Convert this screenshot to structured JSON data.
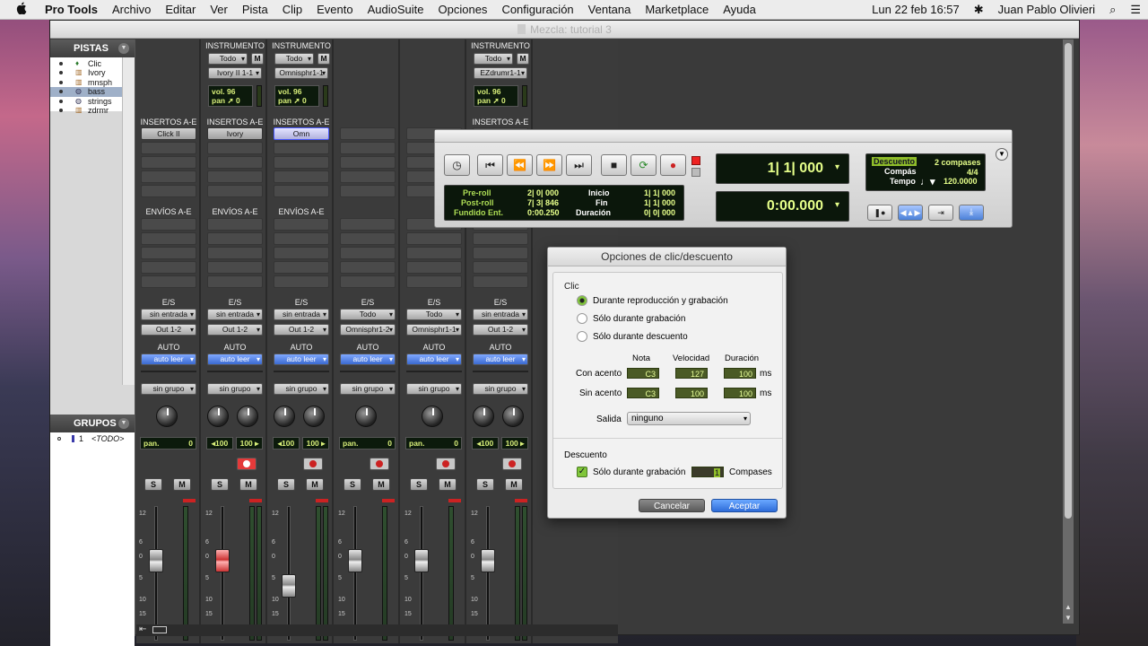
{
  "menubar": {
    "apple": "",
    "app": "Pro Tools",
    "items": [
      "Archivo",
      "Editar",
      "Ver",
      "Pista",
      "Clip",
      "Evento",
      "AudioSuite",
      "Opciones",
      "Configuración",
      "Ventana",
      "Marketplace",
      "Ayuda"
    ],
    "clock": "Lun 22 feb  16:57",
    "user": "Juan Pablo Olivieri",
    "search_icon": "⌕",
    "list_icon": "☰"
  },
  "window": {
    "title": "Mezcla: tutorial 3"
  },
  "tracks_panel": {
    "title": "PISTAS",
    "tracks": [
      {
        "name": "Clic",
        "icon": "metronome-icon"
      },
      {
        "name": "Ivory",
        "icon": "instrument-icon"
      },
      {
        "name": "mnsph",
        "icon": "instrument-icon"
      },
      {
        "name": "bass",
        "icon": "audio-icon"
      },
      {
        "name": "strings",
        "icon": "audio-icon"
      },
      {
        "name": "zdrmr",
        "icon": "instrument-icon"
      }
    ],
    "groups_title": "GRUPOS",
    "group_num": "1",
    "group_name": "<TODO>"
  },
  "mixer": {
    "strips": [
      {
        "header": "",
        "todo": "",
        "m": "",
        "inst": "",
        "vol": "",
        "pan": "",
        "insert_label": "INSERTOS A-E",
        "insert1": "Click II",
        "sends_label": "ENVÍOS A-E",
        "io_label": "E/S",
        "in": "sin entrada",
        "out": "Out 1-2",
        "auto_label": "AUTO",
        "auto": "auto leer",
        "group": "sin grupo",
        "pan_l": "pan.",
        "pan_r": "0",
        "s": "S",
        "mm": "M",
        "stereo": false,
        "armed": false,
        "rec": false,
        "fader_color": ""
      },
      {
        "header": "INSTRUMENTO",
        "todo": "Todo",
        "m": "M",
        "inst": "Ivory II 1-1",
        "vol": "vol.  96",
        "pan": "pan ➚ 0",
        "insert_label": "INSERTOS A-E",
        "insert1": "Ivory",
        "sends_label": "ENVÍOS A-E",
        "io_label": "E/S",
        "in": "sin entrada",
        "out": "Out 1-2",
        "auto_label": "AUTO",
        "auto": "auto leer",
        "group": "sin grupo",
        "pan_l": "◂100",
        "pan_r": "100 ▸",
        "s": "S",
        "mm": "M",
        "stereo": true,
        "armed": true,
        "rec": true,
        "fader_color": "red"
      },
      {
        "header": "INSTRUMENTO",
        "todo": "Todo",
        "m": "M",
        "inst": "Omnisphr1-1",
        "vol": "vol.  96",
        "pan": "pan ➚ 0",
        "insert_label": "INSERTOS A-E",
        "insert1": "Omn",
        "sends_label": "ENVÍOS A-E",
        "io_label": "E/S",
        "in": "sin entrada",
        "out": "Out 1-2",
        "auto_label": "AUTO",
        "auto": "auto leer",
        "group": "sin grupo",
        "pan_l": "◂100",
        "pan_r": "100 ▸",
        "s": "S",
        "mm": "M",
        "stereo": true,
        "armed": false,
        "rec": true,
        "fader_color": ""
      },
      {
        "header": "",
        "todo": "",
        "m": "",
        "inst": "",
        "vol": "",
        "pan": "",
        "insert_label": "",
        "insert1": "",
        "sends_label": "",
        "io_label": "E/S",
        "in": "Todo",
        "out": "Omnisphr1-2",
        "auto_label": "AUTO",
        "auto": "auto leer",
        "group": "sin grupo",
        "pan_l": "pan.",
        "pan_r": "0",
        "s": "S",
        "mm": "M",
        "stereo": false,
        "armed": false,
        "rec": true,
        "fader_color": ""
      },
      {
        "header": "",
        "todo": "",
        "m": "",
        "inst": "",
        "vol": "",
        "pan": "",
        "insert_label": "",
        "insert1": "",
        "sends_label": "",
        "io_label": "E/S",
        "in": "Todo",
        "out": "Omnisphr1-1",
        "auto_label": "AUTO",
        "auto": "auto leer",
        "group": "sin grupo",
        "pan_l": "pan.",
        "pan_r": "0",
        "s": "S",
        "mm": "M",
        "stereo": false,
        "armed": false,
        "rec": true,
        "fader_color": ""
      },
      {
        "header": "INSTRUMENTO",
        "todo": "Todo",
        "m": "M",
        "inst": "EZdrumr1-1",
        "vol": "vol.  96",
        "pan": "pan ➚ 0",
        "insert_label": "INSERTOS A-E",
        "insert1": "",
        "sends_label": "",
        "io_label": "E/S",
        "in": "sin entrada",
        "out": "Out 1-2",
        "auto_label": "AUTO",
        "auto": "auto leer",
        "group": "sin grupo",
        "pan_l": "◂100",
        "pan_r": "100 ▸",
        "s": "S",
        "mm": "M",
        "stereo": true,
        "armed": false,
        "rec": true,
        "fader_color": ""
      }
    ]
  },
  "transport": {
    "preroll_label": "Pre-roll",
    "preroll": "2| 0| 000",
    "postroll_label": "Post-roll",
    "postroll": "7| 3| 846",
    "fade_label": "Fundido Ent.",
    "fade": "0:00.250",
    "inicio_label": "Inicio",
    "inicio": "1| 1| 000",
    "fin_label": "Fin",
    "fin": "1| 1| 000",
    "duracion_label": "Duración",
    "duracion": "0| 0| 000",
    "main_counter": "1| 1| 000",
    "sub_counter": "0:00.000",
    "descuento_label": "Descuento",
    "descuento": "2 compases",
    "compas_label": "Compás",
    "compas": "4/4",
    "tempo_label": "Tempo",
    "tempo": "120.0000"
  },
  "dialog": {
    "title": "Opciones de clic/descuento",
    "clic_label": "Clic",
    "radio1": "Durante reproducción y grabación",
    "radio2": "Sólo durante grabación",
    "radio3": "Sólo durante descuento",
    "col_nota": "Nota",
    "col_vel": "Velocidad",
    "col_dur": "Duración",
    "row1_label": "Con acento",
    "row1_nota": "C3",
    "row1_vel": "127",
    "row1_dur": "100",
    "row1_unit": "ms",
    "row2_label": "Sin acento",
    "row2_nota": "C3",
    "row2_vel": "100",
    "row2_dur": "100",
    "row2_unit": "ms",
    "salida_label": "Salida",
    "salida": "ninguno",
    "descuento_label": "Descuento",
    "check_label": "Sólo durante grabación",
    "compases_value": "1",
    "compases_label": "Compases",
    "cancel": "Cancelar",
    "accept": "Aceptar"
  }
}
